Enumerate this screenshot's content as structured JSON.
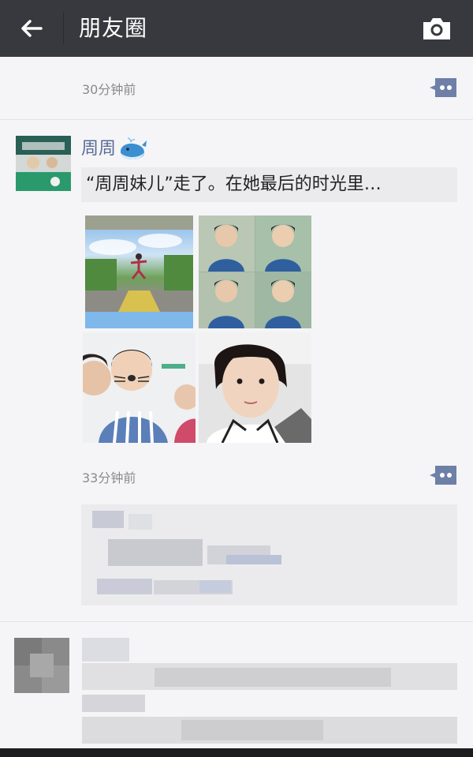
{
  "header": {
    "title": "朋友圈"
  },
  "post1": {
    "time": "30分钟前"
  },
  "post2": {
    "username": "周周",
    "quote": "“周周妹儿”走了。在她最后的时光里…",
    "time": "33分钟前"
  },
  "colors": {
    "topbar": "#38393e",
    "background": "#f5f5f7",
    "username": "#576b95",
    "comment_icon": "#576b95"
  },
  "icons": [
    "back-arrow-icon",
    "camera-icon",
    "comment-icon",
    "whale-emoji-icon"
  ]
}
